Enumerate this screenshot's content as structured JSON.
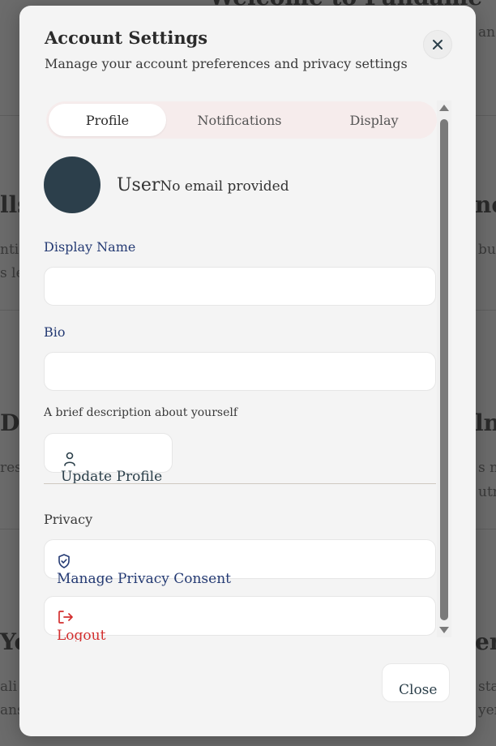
{
  "background": {
    "heading_top": "Welcome to Fundame",
    "top_right_fragment": "an",
    "row1_left_heading": "lls",
    "row1_left_line1": "nti",
    "row1_left_line2": "s le",
    "row1_right_heading": "nc",
    "row1_right_line1": "bu",
    "row2_left_heading": "Do",
    "row2_left_line1": "res",
    "row2_right_heading": "ln",
    "row2_right_line1": "s n",
    "row2_right_line2": "utr",
    "row3_left_heading": "Yo",
    "row3_left_line1": "ali",
    "row3_left_line2": "ans",
    "row3_right_heading": "erg",
    "row3_right_line1": "sta",
    "row3_right_line2": "yen"
  },
  "modal": {
    "title": "Account Settings",
    "subtitle": "Manage your account preferences and privacy settings",
    "close_icon": "close-icon",
    "tabs": [
      {
        "label": "Profile",
        "active": true
      },
      {
        "label": "Notifications",
        "active": false
      },
      {
        "label": "Display",
        "active": false
      }
    ],
    "profile": {
      "avatar_color": "#2c3f4b",
      "name": "User",
      "email": "No email provided",
      "display_name_label": "Display Name",
      "display_name_value": "",
      "bio_label": "Bio",
      "bio_value": "",
      "bio_helper": "A brief description about yourself",
      "update_button": {
        "label": "Update Profile",
        "icon": "user-icon"
      }
    },
    "privacy": {
      "section_label": "Privacy",
      "manage_button": {
        "label": "Manage Privacy Consent",
        "icon": "shield-check-icon"
      },
      "logout_button": {
        "label": "Logout",
        "icon": "logout-icon"
      }
    },
    "footer": {
      "close_label": "Close"
    },
    "colors": {
      "accent_blue": "#243a73",
      "danger_red": "#d32f2f",
      "tab_bg": "#f6ecec"
    }
  }
}
